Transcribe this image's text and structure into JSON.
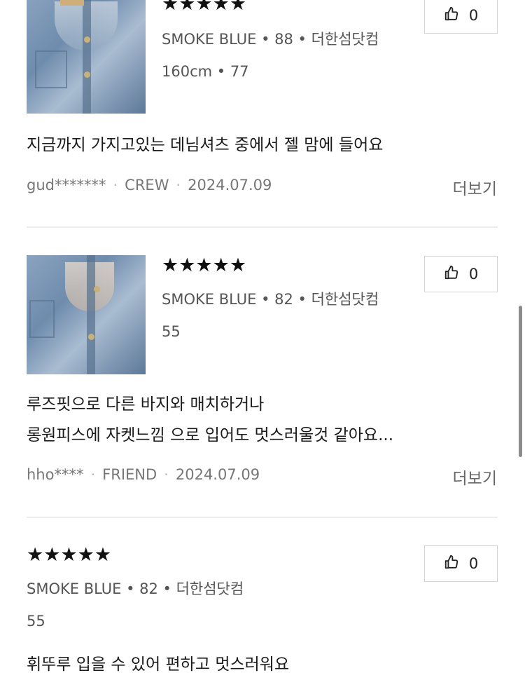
{
  "reviews": [
    {
      "rating_stars": "★★★★★",
      "option": "SMOKE BLUE • 88 • 더한섬닷컴",
      "size": "160cm • 77",
      "text_lines": [
        "지금까지 가지고있는 데님셔츠 중에서 젤 맘에 들어요"
      ],
      "user": "gud*******",
      "tier": "CREW",
      "date": "2024.07.09",
      "more": "더보기",
      "likes": "0"
    },
    {
      "rating_stars": "★★★★★",
      "option": "SMOKE BLUE • 82 • 더한섬닷컴",
      "size": "55",
      "text_lines": [
        "루즈핏으로 다른 바지와 매치하거나",
        "롱원피스에 자켓느낌 으로 입어도 멋스러울것 같아요..."
      ],
      "user": "hho****",
      "tier": "FRIEND",
      "date": "2024.07.09",
      "more": "더보기",
      "likes": "0"
    },
    {
      "rating_stars": "★★★★★",
      "option": "SMOKE BLUE • 82 • 더한섬닷컴",
      "size": "55",
      "text_lines": [
        "휘뚜루 입을 수 있어 편하고 멋스러워요"
      ],
      "likes": "0"
    }
  ],
  "icons": {
    "like": "thumbs-up-icon"
  }
}
